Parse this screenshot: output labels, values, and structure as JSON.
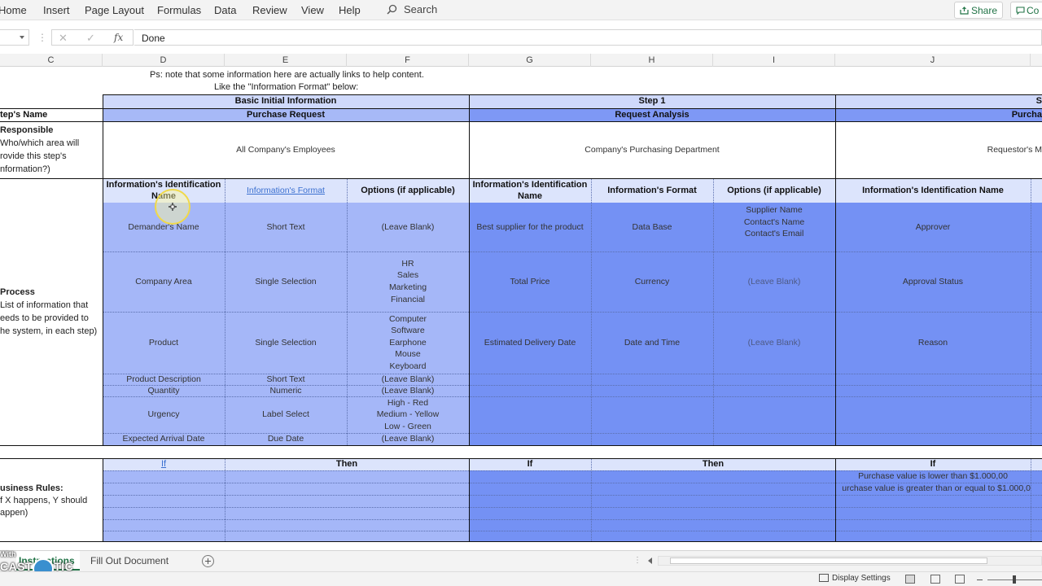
{
  "ribbon": {
    "tabs": [
      "Home",
      "Insert",
      "Page Layout",
      "Formulas",
      "Data",
      "Review",
      "View",
      "Help"
    ],
    "search_label": "Search",
    "share_label": "Share",
    "comments_label": "Co"
  },
  "formula_bar": {
    "fx_label": "fx",
    "value": "Done"
  },
  "columns": [
    "C",
    "D",
    "E",
    "F",
    "G",
    "H",
    "I",
    "J"
  ],
  "notes": {
    "line1": "Ps: note that some information here are actually links to help content.",
    "line2": "Like the \"Information Format\" below:"
  },
  "step_headers": {
    "basic": "Basic Initial Information",
    "step1": "Step 1",
    "step2": "S"
  },
  "step_names": {
    "label": "tep's Name",
    "basic": "Purchase Request",
    "step1": "Request Analysis",
    "step2": "Purcha"
  },
  "responsible": {
    "title": "Responsible",
    "desc_lines": [
      "Who/which area will",
      "rovide this step's",
      "nformation?)"
    ],
    "basic": "All Company's Employees",
    "step1": "Company's Purchasing Department",
    "step2": "Requestor's M"
  },
  "process": {
    "title": "Process",
    "desc_lines": [
      "List of information that",
      "eeds to be provided to",
      "he system, in each step)"
    ],
    "headers": {
      "id_name": "Information's Identification Name",
      "format": "Information's Format",
      "options": "Options (if applicable)",
      "id_name_j": "Information's Identification Name"
    },
    "basic_rows": [
      {
        "name": "Demander's Name",
        "format": "Short Text",
        "options": "(Leave Blank)"
      },
      {
        "name": "Company Area",
        "format": "Single Selection",
        "options": "HR\nSales\nMarketing\nFinancial"
      },
      {
        "name": "Product",
        "format": "Single Selection",
        "options": "Computer\nSoftware\nEarphone\nMouse\nKeyboard"
      },
      {
        "name": "Product Description",
        "format": "Short Text",
        "options": "(Leave Blank)"
      },
      {
        "name": "Quantity",
        "format": "Numeric",
        "options": "(Leave Blank)"
      },
      {
        "name": "Urgency",
        "format": "Label Select",
        "options": "High - Red\nMedium - Yellow\nLow - Green"
      },
      {
        "name": "Expected Arrival Date",
        "format": "Due Date",
        "options": "(Leave Blank)"
      }
    ],
    "step1_rows": [
      {
        "name": "Best supplier for the product",
        "format": "Data Base",
        "options": "Supplier Name\nContact's Name\nContact's Email"
      },
      {
        "name": "Total Price",
        "format": "Currency",
        "options": "(Leave Blank)"
      },
      {
        "name": "Estimated Delivery Date",
        "format": "Date and Time",
        "options": "(Leave Blank)"
      }
    ],
    "step2_rows": [
      "Approver",
      "Approval Status",
      "Reason"
    ]
  },
  "business_rules": {
    "title": "usiness Rules:",
    "desc_lines": [
      "f X happens, Y should",
      "appen)"
    ],
    "if_label": "If",
    "then_label": "Then",
    "step2_if_lines": [
      "Purchase value is lower than $1.000,00",
      "urchase value is greater than or equal to $1.000,0"
    ]
  },
  "sheets": {
    "tabs": [
      "Instructions",
      "Fill Out Document"
    ],
    "active": "Instructions"
  },
  "watermark": {
    "with": "With",
    "brand": "CAST  MATIC"
  },
  "status": {
    "display_settings": "Display Settings"
  },
  "colors": {
    "excel_green": "#217346",
    "light_blue": "#c4d0f9",
    "mid_blue": "#a5b7f8",
    "dark_blue": "#7491f4"
  }
}
